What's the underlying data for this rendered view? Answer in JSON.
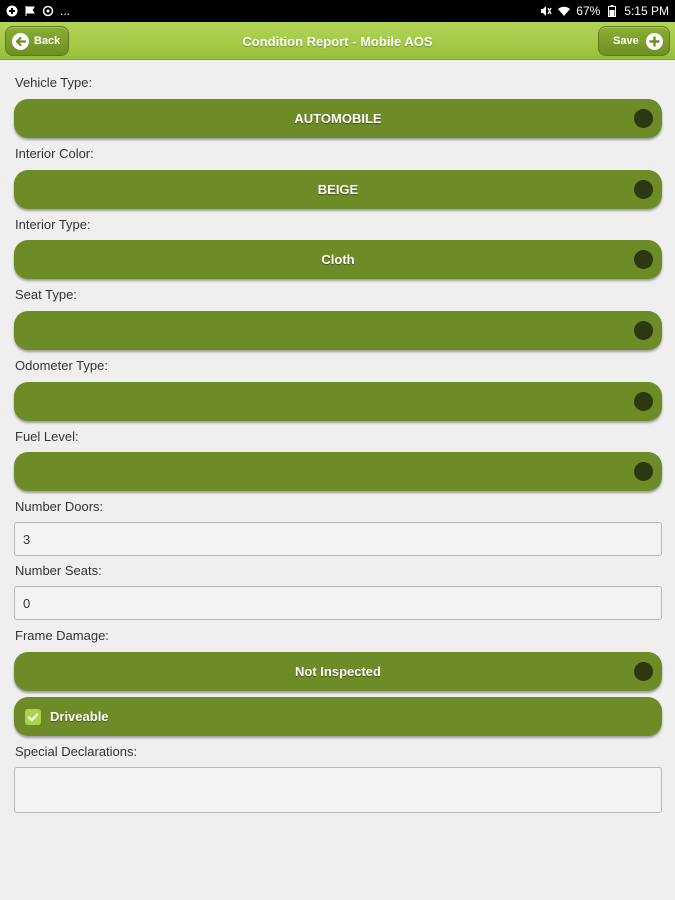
{
  "status_bar": {
    "battery": "67%",
    "time": "5:15 PM",
    "more": "..."
  },
  "header": {
    "back_label": "Back",
    "title": "Condition Report - Mobile AOS",
    "save_label": "Save"
  },
  "form": {
    "vehicle_type": {
      "label": "Vehicle Type:",
      "value": "AUTOMOBILE"
    },
    "interior_color": {
      "label": "Interior Color:",
      "value": "BEIGE"
    },
    "interior_type": {
      "label": "Interior Type:",
      "value": "Cloth"
    },
    "seat_type": {
      "label": "Seat Type:",
      "value": ""
    },
    "odometer_type": {
      "label": "Odometer Type:",
      "value": ""
    },
    "fuel_level": {
      "label": "Fuel Level:",
      "value": ""
    },
    "number_doors": {
      "label": "Number Doors:",
      "value": "3"
    },
    "number_seats": {
      "label": "Number Seats:",
      "value": "0"
    },
    "frame_damage": {
      "label": "Frame Damage:",
      "value": "Not Inspected"
    },
    "driveable": {
      "label": "Driveable",
      "checked": true
    },
    "special_declarations": {
      "label": "Special Declarations:",
      "value": ""
    }
  },
  "colors": {
    "header_green": "#a8cd4d",
    "pill_green": "#6d8b27",
    "background": "#efefef"
  }
}
